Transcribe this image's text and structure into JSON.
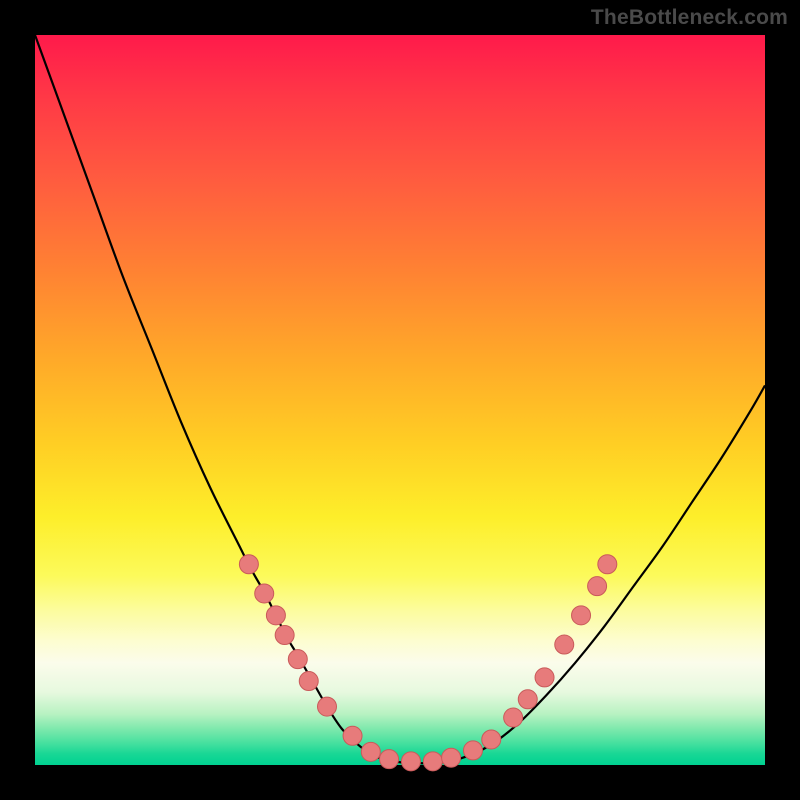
{
  "watermark": "TheBottleneck.com",
  "colors": {
    "background": "#000000",
    "curve": "#000000",
    "point_fill": "#e77b7b",
    "point_stroke": "#c95a5a",
    "gradient_top": "#ff1a4b",
    "gradient_bottom": "#00d291"
  },
  "chart_data": {
    "type": "line",
    "title": "",
    "xlabel": "",
    "ylabel": "",
    "xlim": [
      0,
      100
    ],
    "ylim": [
      0,
      100
    ],
    "grid": false,
    "legend": false,
    "series": [
      {
        "name": "bottleneck-curve",
        "x": [
          0,
          4,
          8,
          12,
          16,
          20,
          24,
          28,
          29.5,
          31.5,
          33,
          34.5,
          36,
          38,
          40,
          42,
          44,
          46,
          48,
          51,
          55,
          58,
          62,
          66,
          70,
          74,
          78,
          82,
          86,
          90,
          94,
          98,
          100
        ],
        "y": [
          100,
          89,
          78,
          67,
          57,
          47,
          38,
          30,
          27,
          23.5,
          20.5,
          17.5,
          15,
          11.5,
          8,
          5,
          3,
          1.5,
          0.7,
          0.3,
          0.3,
          0.8,
          2.5,
          5.5,
          9.5,
          14,
          19,
          24.5,
          30,
          36,
          42,
          48.5,
          52
        ]
      }
    ],
    "points": [
      {
        "x": 29.3,
        "y": 27.5
      },
      {
        "x": 31.4,
        "y": 23.5
      },
      {
        "x": 33.0,
        "y": 20.5
      },
      {
        "x": 34.2,
        "y": 17.8
      },
      {
        "x": 36.0,
        "y": 14.5
      },
      {
        "x": 37.5,
        "y": 11.5
      },
      {
        "x": 40.0,
        "y": 8.0
      },
      {
        "x": 43.5,
        "y": 4.0
      },
      {
        "x": 46.0,
        "y": 1.8
      },
      {
        "x": 48.5,
        "y": 0.8
      },
      {
        "x": 51.5,
        "y": 0.5
      },
      {
        "x": 54.5,
        "y": 0.5
      },
      {
        "x": 57.0,
        "y": 1.0
      },
      {
        "x": 60.0,
        "y": 2.0
      },
      {
        "x": 62.5,
        "y": 3.5
      },
      {
        "x": 65.5,
        "y": 6.5
      },
      {
        "x": 67.5,
        "y": 9.0
      },
      {
        "x": 69.8,
        "y": 12.0
      },
      {
        "x": 72.5,
        "y": 16.5
      },
      {
        "x": 74.8,
        "y": 20.5
      },
      {
        "x": 77.0,
        "y": 24.5
      },
      {
        "x": 78.4,
        "y": 27.5
      }
    ],
    "point_radius": 9.5
  }
}
